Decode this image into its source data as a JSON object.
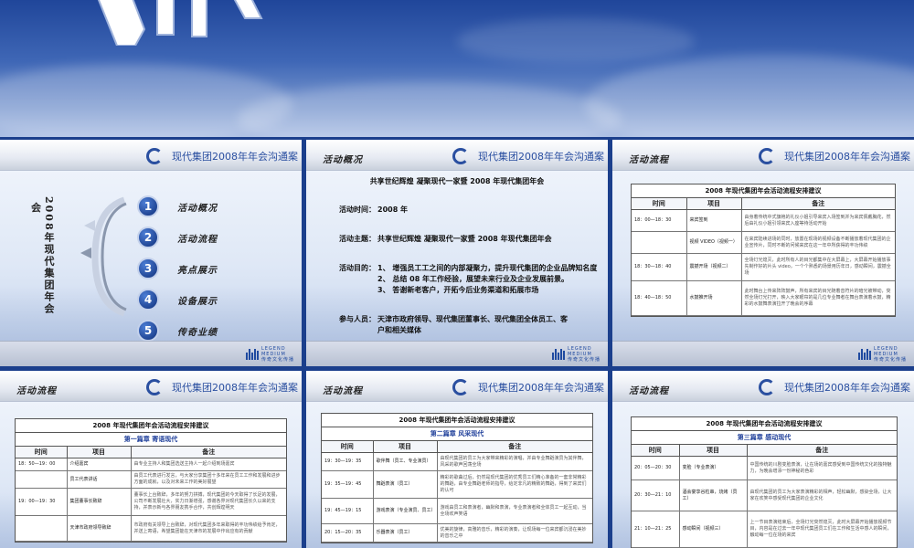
{
  "header_title": "现代集团2008年年会沟通案",
  "footer_logo": {
    "line1": "LEGEND",
    "line2": "MEDIUM",
    "line3": "传奇文化传播"
  },
  "slide1": {
    "vertical_title": "2008年现代集团年会",
    "agenda": [
      {
        "num": "1",
        "label": "活动概况"
      },
      {
        "num": "2",
        "label": "活动流程"
      },
      {
        "num": "3",
        "label": "亮点展示"
      },
      {
        "num": "4",
        "label": "设备展示"
      },
      {
        "num": "5",
        "label": "传奇业绩"
      }
    ]
  },
  "slide2": {
    "section": "活动概况",
    "headline": "共享世纪辉煌 凝聚现代一家暨 2008 年现代集团年会",
    "time_key": "活动时间：",
    "time_val": "2008 年",
    "theme_key": "活动主题：",
    "theme_val": "共享世纪辉煌 凝聚现代一家暨 2008 年现代集团年会",
    "goal_key": "活动目的：",
    "goals": [
      "1、 增强员工工之间的内部凝聚力，提升现代集团的企业品牌知名度",
      "2、 总结 08 年工作经验，展望未来行业及企业发展前景。",
      "3、 答谢新老客户，开拓今后业务渠道和拓展市场"
    ],
    "people_key": "参与人员：",
    "people_val": "天津市政府领导、现代集团董事长、现代集团全体员工、客户和相关媒体"
  },
  "slide3": {
    "section": "活动流程",
    "caption": "2008 年现代集团年会活动流程安排建议",
    "cols": [
      "时间",
      "项目",
      "备注"
    ],
    "rows": [
      {
        "time": "18：00—18：30",
        "item": "来宾签到",
        "note": "由身着传统中式旗袍的礼仪小姐引导来宾入场签到并为来宾佩戴胸花，然后由礼仪小姐引领来宾入座等待活动开始"
      },
      {
        "time": "",
        "item": "视频 VIDEO（视频一）",
        "note": "在来宾陆续进场的同时，放置在现场的视频设备不断播放着现代集团的企业宣传片，同时不断的问候来宾在这一年中所获得的丰功伟绩"
      },
      {
        "time": "18：30—18：40",
        "item": "震撼开场（视频二）",
        "note": "全场灯光熄灭，此时所有人的目光都集中在大屏幕上，大屏幕开始播放事先制作好的片头 video，一个个熟悉的场景用历年日，感动瞬间，震撼全场"
      },
      {
        "time": "18：40—18：50",
        "item": "水鼓推开场",
        "note": "此时舞台上传来阵阵鼓声，所有来宾的目光随着音符片的暗光被带动，突然全场灯光打开，映入大家眼帘的是几位专业舞者在舞台表演着水鼓，精彩的水鼓舞表演拉开了晚会的序幕"
      }
    ]
  },
  "slide4": {
    "section": "活动流程",
    "caption": "2008 年现代集团年会活动流程安排建议",
    "subtitle": "第一篇章 寄语现代",
    "cols": [
      "时间",
      "项目",
      "备注"
    ],
    "rows": [
      {
        "time": "18：50—19：00",
        "item": "介绍嘉宾",
        "note": "由专业主持人和集团选送主持人一起介绍到场嘉宾"
      },
      {
        "time": "",
        "item": "员工代表讲话",
        "note": "由员工代表进行发言，与大家分享集团十多年来在员工工作和发展和进步方面的成就，以及对未来工作的美好展望"
      },
      {
        "time": "19：00—19：30",
        "item": "集团董事长致辞",
        "note": "董事长上台致辞，多年的努力拼搏，现代集团的今天取得了长足的发展，公司不断发展壮大，实力日渐增强，感谢各界对现代集团长久以来的支持，并表示新与各界朋友携手合作，共创辉煌明天"
      },
      {
        "time": "",
        "item": "天津市政府领导致辞",
        "note": "市政府有关领导上台致辞，对现代集团多年来取得的丰功伟绩给予肯定，并送上寄语，希望集团能在天津市的发展中作出应有的贡献"
      }
    ]
  },
  "slide5": {
    "section": "活动流程",
    "caption": "2008 年现代集团年会活动流程安排建议",
    "subtitle": "第二篇章 风采现代",
    "cols": [
      "时间",
      "项目",
      "备注"
    ],
    "rows": [
      {
        "time": "19：30—19：35",
        "item": "歌伴舞（员工、专业演员）",
        "note": "由现代集团的员工为大家带来精彩的演唱，并由专业舞蹈演员为其伴舞，风采的歌声回荡全场"
      },
      {
        "time": "19：35—19：45",
        "item": "舞蹈表演（员工）",
        "note": "精彩的歌曲过后，仍然是现代集团的优秀员工们精心准备的一套非常精彩的舞蹈，由专业舞蹈老师的指导，给定非凡的精致的舞蹈，得到了来宾们的认可"
      },
      {
        "time": "19：45—19：15",
        "item": "游戏表演（专业演员、员工）",
        "note": "游戏由员工和表演者，幽默和表演，专业表演者和全体员工一起互动，当全场欢声笑语"
      },
      {
        "time": "20：15—20：35",
        "item": "乐器表演（员工）",
        "note": "优美的旋律，高雅的音乐，精彩的演奏，让现场每一位来宾都沉浸在美妙的音乐之中"
      }
    ]
  },
  "slide6": {
    "section": "活动流程",
    "caption": "2008 年现代集团年会活动流程安排建议",
    "subtitle": "第三篇章 感动现代",
    "cols": [
      "时间",
      "项目",
      "备注"
    ],
    "rows": [
      {
        "time": "20：05—20：30",
        "item": "变脸（专业表演）",
        "note": "中国传统的川剧变脸表演，让在场的嘉宾感受到中国传统文化的独特魅力，为晚会增添一份神秘的色彩"
      },
      {
        "time": "20：30—21：10",
        "item": "酒会宴享谷粒串，烧烤（员工）",
        "note": "由现代集团的员工为大家表演精彩的相声，轻松幽默，感染全场，让大家在欢笑中感受现代集团的企业文化"
      },
      {
        "time": "21：10—21：25",
        "item": "感动瞬间（视频三）",
        "note": "上一节目表演结束后，全场灯光突然熄灭，此时大屏幕开始播放视频节目，内容是在过去一年中现代集团员工们在工作和生活中感人的瞬间，触动每一位在场的来宾"
      }
    ]
  }
}
